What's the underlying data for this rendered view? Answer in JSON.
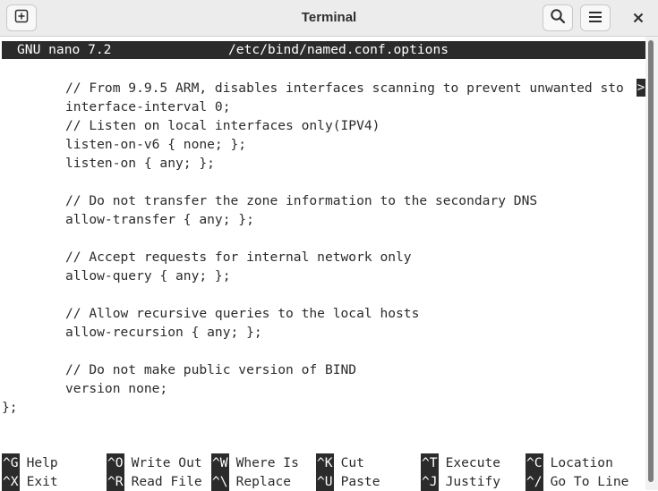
{
  "window": {
    "title": "Terminal",
    "icons": [
      "new-tab-icon",
      "search-icon",
      "hamburger-menu-icon",
      "close-icon"
    ]
  },
  "nano": {
    "version": "GNU nano 7.2",
    "filename": "/etc/bind/named.conf.options",
    "overflow_marker": ">"
  },
  "code": [
    "// From 9.9.5 ARM, disables interfaces scanning to prevent unwanted sto",
    "interface-interval 0;",
    "// Listen on local interfaces only(IPV4)",
    "listen-on-v6 { none; };",
    "listen-on { any; };",
    "",
    "// Do not transfer the zone information to the secondary DNS",
    "allow-transfer { any; };",
    "",
    "// Accept requests for internal network only",
    "allow-query { any; };",
    "",
    "// Allow recursive queries to the local hosts",
    "allow-recursion { any; };",
    "",
    "// Do not make public version of BIND",
    "version none;"
  ],
  "closing": "};",
  "shortcuts": [
    {
      "key": "^G",
      "label": "Help"
    },
    {
      "key": "^O",
      "label": "Write Out"
    },
    {
      "key": "^W",
      "label": "Where Is"
    },
    {
      "key": "^K",
      "label": "Cut"
    },
    {
      "key": "^T",
      "label": "Execute"
    },
    {
      "key": "^C",
      "label": "Location"
    },
    {
      "key": "^X",
      "label": "Exit"
    },
    {
      "key": "^R",
      "label": "Read File"
    },
    {
      "key": "^\\",
      "label": "Replace"
    },
    {
      "key": "^U",
      "label": "Paste"
    },
    {
      "key": "^J",
      "label": "Justify"
    },
    {
      "key": "^/",
      "label": "Go To Line"
    }
  ],
  "colors": {
    "background": "#ffffff",
    "foreground": "#2b2b2b",
    "header_bg": "#ececec"
  }
}
